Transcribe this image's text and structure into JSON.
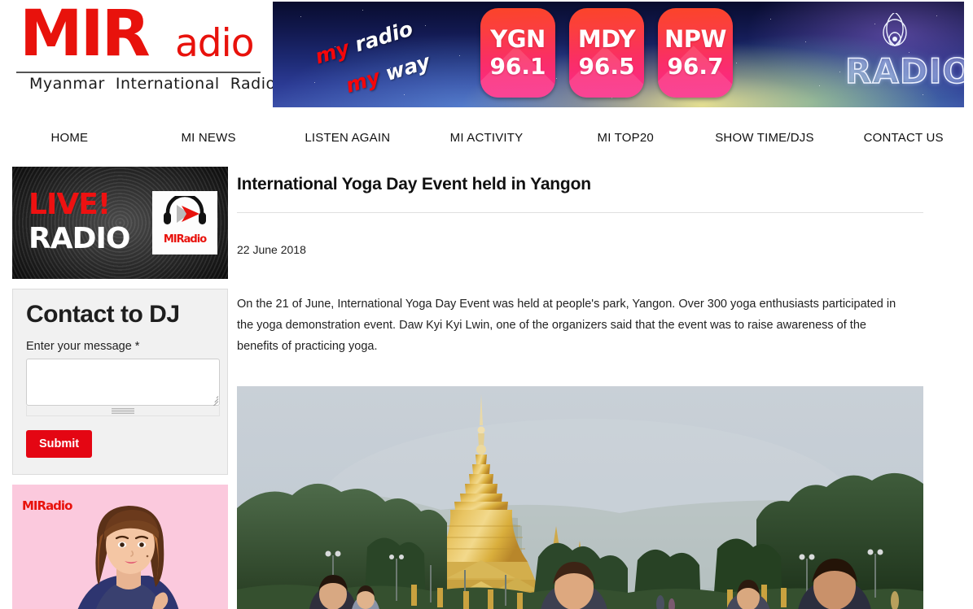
{
  "site": {
    "logo_main": "MIR",
    "logo_suffix": "adio",
    "logo_tagline": "Myanmar  International  Radio"
  },
  "banner": {
    "tagline_line1_red": "my",
    "tagline_line1_white": "radio",
    "tagline_line2_red": "my",
    "tagline_line2_white": "way",
    "radio_mark": "RADIO",
    "stations": [
      {
        "city": "YGN",
        "frequency": "96.1"
      },
      {
        "city": "MDY",
        "frequency": "96.5"
      },
      {
        "city": "NPW",
        "frequency": "96.7"
      }
    ],
    "colors": {
      "badge_top": "#fb4429",
      "badge_bottom": "#f92b88",
      "sky_dark": "#080c2e"
    }
  },
  "nav": {
    "items": [
      {
        "label": "HOME"
      },
      {
        "label": "MI NEWS"
      },
      {
        "label": "LISTEN AGAIN"
      },
      {
        "label": "MI ACTIVITY"
      },
      {
        "label": "MI TOP20"
      },
      {
        "label": "SHOW TIME/DJS"
      },
      {
        "label": "CONTACT US"
      }
    ]
  },
  "sidebar": {
    "live_widget": {
      "line1": "LIVE!",
      "line2": "RADIO",
      "logo_main": "MIR",
      "logo_suffix": "adio"
    },
    "contact_form": {
      "title": "Contact to DJ",
      "message_label": "Enter your message *",
      "message_value": "",
      "message_placeholder": "",
      "submit_label": "Submit"
    },
    "dj_widget": {
      "logo_main": "MIR",
      "logo_suffix": "adio"
    }
  },
  "article": {
    "title": "International Yoga Day Event held in Yangon",
    "date": "22 June 2018",
    "body": "On the 21 of June, International Yoga Day Event was held at people's park, Yangon. Over 300 yoga enthusiasts  participated in the yoga demonstration event. Daw Kyi Kyi Lwin, one of the organizers said that the event was to raise awareness of the benefits of practicing yoga.",
    "photo_caption": ""
  },
  "theme": {
    "brand_red": "#e8120c",
    "submit_red": "#e40613",
    "panel_grey": "#f1f1f1",
    "dj_pink": "#fbc9dd"
  }
}
